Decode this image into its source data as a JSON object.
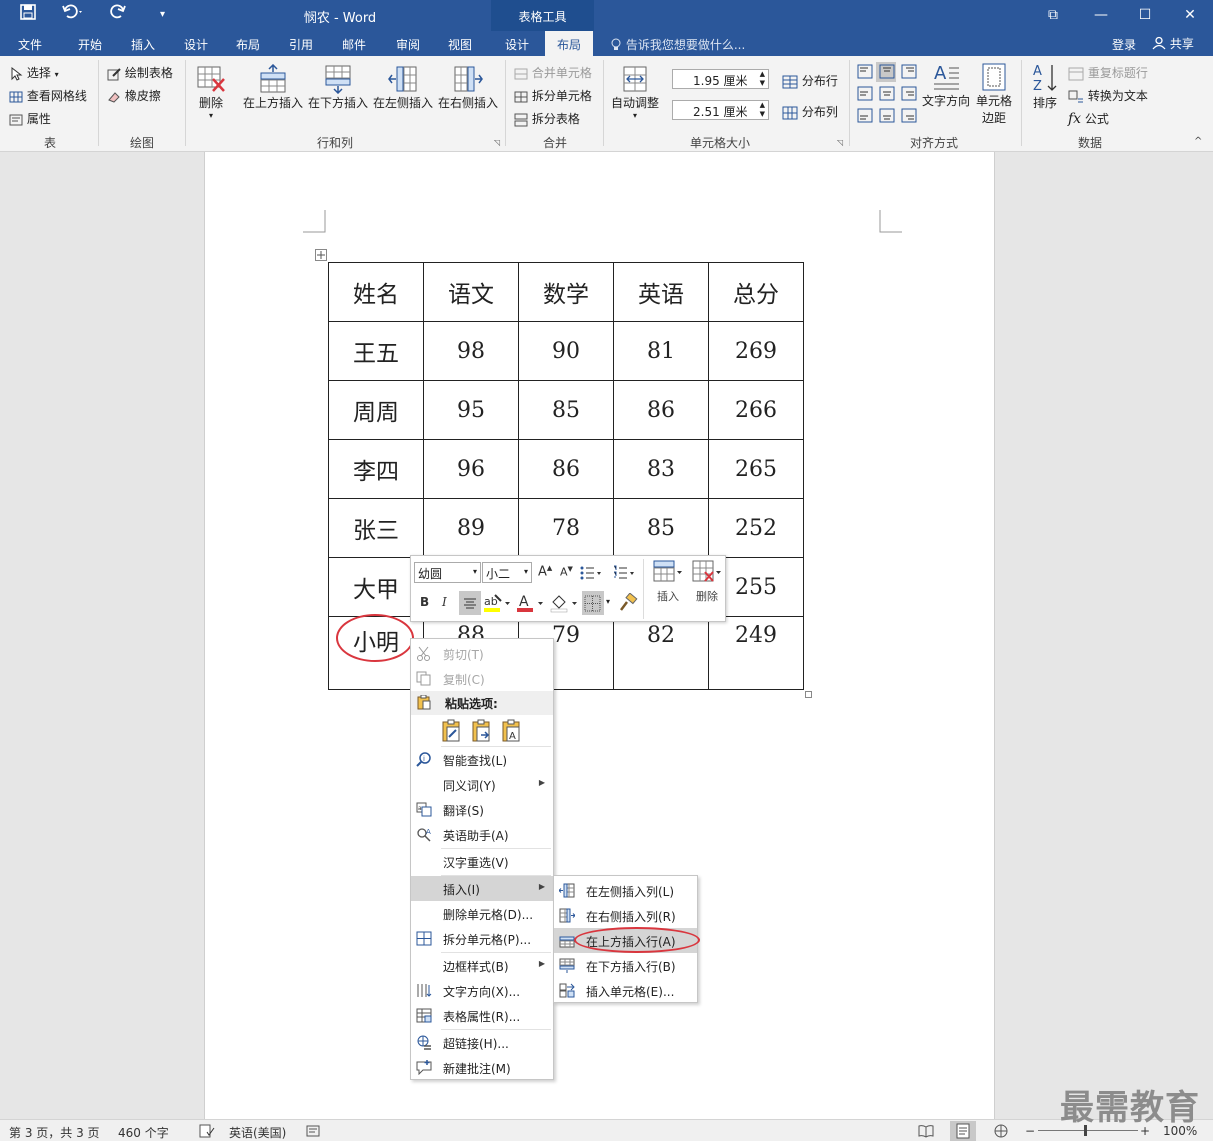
{
  "titlebar": {
    "doc_title": "悯农 - Word",
    "contextual_group": "表格工具",
    "win_restore": "⧉",
    "win_min": "—",
    "win_max": "☐",
    "win_close": "✕"
  },
  "tabs": [
    "文件",
    "开始",
    "插入",
    "设计",
    "布局",
    "引用",
    "邮件",
    "审阅",
    "视图",
    "设计",
    "布局"
  ],
  "active_tab_index": 10,
  "tell_me": "告诉我您想要做什么...",
  "signin": "登录",
  "share": "共享",
  "ribbon": {
    "group_table": {
      "label": "表",
      "select": "选择",
      "gridlines": "查看网格线",
      "properties": "属性"
    },
    "group_draw": {
      "label": "绘图",
      "draw_table": "绘制表格",
      "eraser": "橡皮擦"
    },
    "group_rowscols": {
      "label": "行和列",
      "delete": "删除",
      "insert_above": "在上方插入",
      "insert_below": "在下方插入",
      "insert_left": "在左侧插入",
      "insert_right": "在右侧插入"
    },
    "group_merge": {
      "label": "合并",
      "merge_cells": "合并单元格",
      "split_cells": "拆分单元格",
      "split_table": "拆分表格"
    },
    "group_cellsize": {
      "label": "单元格大小",
      "autofit": "自动调整",
      "height": "1.95 厘米",
      "width": "2.51 厘米",
      "distribute_rows": "分布行",
      "distribute_cols": "分布列"
    },
    "group_align": {
      "label": "对齐方式",
      "text_direction": "文字方向",
      "cell_margins_1": "单元格",
      "cell_margins_2": "边距"
    },
    "group_data": {
      "label": "数据",
      "sort": "排序",
      "repeat_header": "重复标题行",
      "convert_text": "转换为文本",
      "formula": "公式"
    }
  },
  "table": {
    "header": [
      "姓名",
      "语文",
      "数学",
      "英语",
      "总分"
    ],
    "rows": [
      [
        "王五",
        "98",
        "90",
        "81",
        "269"
      ],
      [
        "周周",
        "95",
        "85",
        "86",
        "266"
      ],
      [
        "李四",
        "96",
        "86",
        "83",
        "265"
      ],
      [
        "张三",
        "89",
        "78",
        "85",
        "252"
      ],
      [
        "大甲",
        "",
        "",
        "",
        "255"
      ],
      [
        "小明",
        "88",
        "79",
        "82",
        "249"
      ]
    ]
  },
  "mini_toolbar": {
    "font": "幼圆",
    "size": "小二",
    "insert": "插入",
    "delete": "删除"
  },
  "context_menu": {
    "cut": "剪切(T)",
    "copy": "复制(C)",
    "paste_options": "粘贴选项:",
    "smart_lookup": "智能查找(L)",
    "synonyms": "同义词(Y)",
    "translate": "翻译(S)",
    "english_assistant": "英语助手(A)",
    "hanzi_reselect": "汉字重选(V)",
    "insert": "插入(I)",
    "delete_cells": "删除单元格(D)...",
    "split_cells": "拆分单元格(P)...",
    "border_styles": "边框样式(B)",
    "text_direction": "文字方向(X)...",
    "table_properties": "表格属性(R)...",
    "hyperlink": "超链接(H)...",
    "new_comment": "新建批注(M)"
  },
  "submenu": {
    "insert_left_col": "在左侧插入列(L)",
    "insert_right_col": "在右侧插入列(R)",
    "insert_row_above": "在上方插入行(A)",
    "insert_row_below": "在下方插入行(B)",
    "insert_cells": "插入单元格(E)..."
  },
  "statusbar": {
    "page": "第 3 页，共 3 页",
    "words": "460 个字",
    "language": "英语(美国)",
    "zoom": "100%"
  },
  "watermark": "最需教育",
  "colors": {
    "brand": "#2b579a",
    "highlight_circle": "#d9363e"
  }
}
